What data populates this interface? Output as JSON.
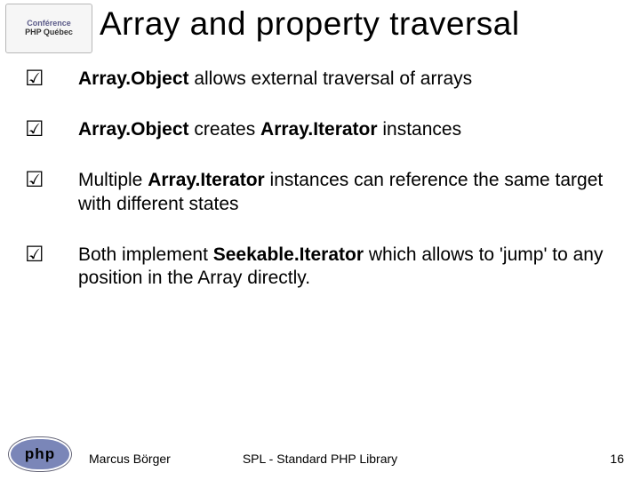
{
  "conference": {
    "line1": "Conférence",
    "line2": "PHP Québec"
  },
  "title": "Array and property traversal",
  "bullets": [
    {
      "segments": [
        {
          "text": "Array.Object",
          "bold": true
        },
        {
          "text": " allows external traversal of arrays"
        }
      ]
    },
    {
      "segments": [
        {
          "text": "Array.Object",
          "bold": true
        },
        {
          "text": " creates "
        },
        {
          "text": "Array.Iterator",
          "bold": true
        },
        {
          "text": " instances"
        }
      ]
    },
    {
      "segments": [
        {
          "text": "Multiple "
        },
        {
          "text": "Array.Iterator",
          "bold": true
        },
        {
          "text": " instances can reference the same target with different states"
        }
      ]
    },
    {
      "segments": [
        {
          "text": "Both implement "
        },
        {
          "text": "Seekable.Iterator",
          "bold": true
        },
        {
          "text": " which allows to 'jump' to any position in the Array directly."
        }
      ]
    }
  ],
  "check_glyph": "☑",
  "footer": {
    "author": "Marcus Börger",
    "center": "SPL - Standard PHP Library",
    "page": "16",
    "php_logo_text": "php"
  }
}
